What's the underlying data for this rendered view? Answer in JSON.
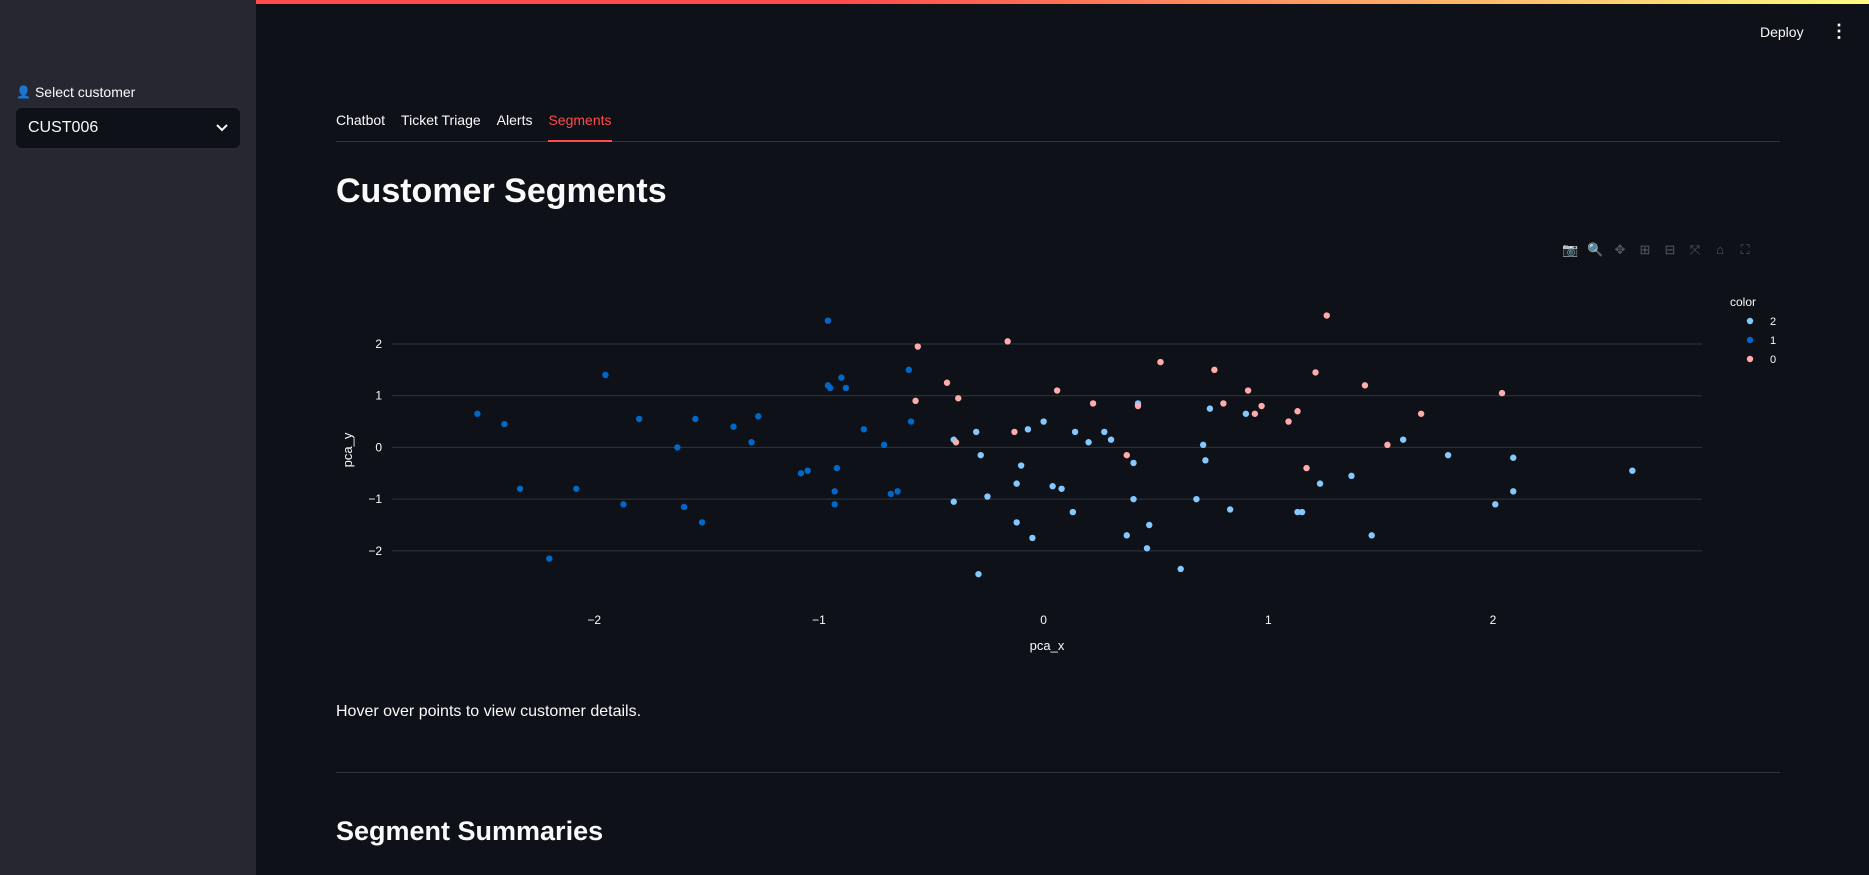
{
  "sidebar": {
    "select_label": "Select customer",
    "selected_customer": "CUST006"
  },
  "header": {
    "deploy_label": "Deploy",
    "menu_icon": "kebab-menu-icon"
  },
  "tabs": [
    {
      "label": "Chatbot",
      "active": false
    },
    {
      "label": "Ticket Triage",
      "active": false
    },
    {
      "label": "Alerts",
      "active": false
    },
    {
      "label": "Segments",
      "active": true
    }
  ],
  "page_title": "Customer Segments",
  "modebar_icons": [
    "camera-icon",
    "zoom-icon",
    "pan-icon",
    "zoom-in-icon",
    "zoom-out-icon",
    "autoscale-icon",
    "home-icon",
    "fullscreen-icon"
  ],
  "caption": "Hover over points to view customer details.",
  "section_title": "Segment Summaries",
  "colors": {
    "accent": "#ff4b4b",
    "bg": "#0e1117",
    "sidebar": "#262730",
    "c2": "#83c9ff",
    "c1": "#0068c9",
    "c0": "#ffabab"
  },
  "chart_data": {
    "type": "scatter",
    "xlabel": "pca_x",
    "ylabel": "pca_y",
    "xlim": [
      -2.9,
      2.93
    ],
    "ylim": [
      -2.95,
      2.85
    ],
    "xticks": [
      -2,
      -1,
      0,
      1,
      2
    ],
    "yticks": [
      -2,
      -1,
      0,
      1,
      2
    ],
    "legend_title": "color",
    "legend_position": "top-right",
    "series": [
      {
        "name": "2",
        "color": "#83c9ff",
        "points": [
          [
            -0.4,
            0.15
          ],
          [
            -0.3,
            0.3
          ],
          [
            -0.28,
            -0.15
          ],
          [
            -0.25,
            -0.95
          ],
          [
            -0.4,
            -1.05
          ],
          [
            -0.29,
            -2.45
          ],
          [
            -0.12,
            -0.7
          ],
          [
            -0.1,
            -0.35
          ],
          [
            -0.07,
            0.35
          ],
          [
            -0.12,
            -1.45
          ],
          [
            -0.05,
            -1.75
          ],
          [
            0.0,
            0.5
          ],
          [
            0.04,
            -0.75
          ],
          [
            0.08,
            -0.8
          ],
          [
            0.14,
            0.3
          ],
          [
            0.13,
            -1.25
          ],
          [
            0.2,
            0.1
          ],
          [
            0.27,
            0.3
          ],
          [
            0.3,
            0.15
          ],
          [
            0.4,
            -0.3
          ],
          [
            0.42,
            0.85
          ],
          [
            0.4,
            -1.0
          ],
          [
            0.37,
            -1.7
          ],
          [
            0.47,
            -1.5
          ],
          [
            0.46,
            -1.95
          ],
          [
            0.61,
            -2.35
          ],
          [
            0.68,
            -1.0
          ],
          [
            0.71,
            0.05
          ],
          [
            0.72,
            -0.25
          ],
          [
            0.74,
            0.75
          ],
          [
            0.83,
            -1.2
          ],
          [
            0.9,
            0.65
          ],
          [
            1.13,
            -1.25
          ],
          [
            1.15,
            -1.25
          ],
          [
            1.23,
            -0.7
          ],
          [
            1.37,
            -0.55
          ],
          [
            1.46,
            -1.7
          ],
          [
            1.6,
            0.15
          ],
          [
            1.8,
            -0.15
          ],
          [
            2.01,
            -1.1
          ],
          [
            2.09,
            -0.85
          ],
          [
            2.09,
            -0.2
          ],
          [
            2.62,
            -0.45
          ]
        ]
      },
      {
        "name": "1",
        "color": "#0068c9",
        "points": [
          [
            -2.52,
            0.65
          ],
          [
            -2.4,
            0.45
          ],
          [
            -2.33,
            -0.8
          ],
          [
            -2.2,
            -2.15
          ],
          [
            -2.08,
            -0.8
          ],
          [
            -1.95,
            1.4
          ],
          [
            -1.87,
            -1.1
          ],
          [
            -1.8,
            0.55
          ],
          [
            -1.63,
            0.0
          ],
          [
            -1.6,
            -1.15
          ],
          [
            -1.55,
            0.55
          ],
          [
            -1.52,
            -1.45
          ],
          [
            -1.38,
            0.4
          ],
          [
            -1.3,
            0.1
          ],
          [
            -1.27,
            0.6
          ],
          [
            -1.08,
            -0.5
          ],
          [
            -1.05,
            -0.45
          ],
          [
            -0.96,
            2.45
          ],
          [
            -0.96,
            1.2
          ],
          [
            -0.95,
            1.15
          ],
          [
            -0.92,
            -0.4
          ],
          [
            -0.93,
            -0.85
          ],
          [
            -0.93,
            -1.1
          ],
          [
            -0.9,
            1.35
          ],
          [
            -0.88,
            1.15
          ],
          [
            -0.8,
            0.35
          ],
          [
            -0.71,
            0.05
          ],
          [
            -0.68,
            -0.9
          ],
          [
            -0.65,
            -0.85
          ],
          [
            -0.6,
            1.5
          ],
          [
            -0.59,
            0.5
          ]
        ]
      },
      {
        "name": "0",
        "color": "#ffabab",
        "points": [
          [
            -0.56,
            1.95
          ],
          [
            -0.57,
            0.9
          ],
          [
            -0.43,
            1.25
          ],
          [
            -0.38,
            0.95
          ],
          [
            -0.39,
            0.1
          ],
          [
            -0.16,
            2.05
          ],
          [
            -0.13,
            0.3
          ],
          [
            0.06,
            1.1
          ],
          [
            0.22,
            0.85
          ],
          [
            0.37,
            -0.15
          ],
          [
            0.42,
            0.8
          ],
          [
            0.52,
            1.65
          ],
          [
            0.76,
            1.5
          ],
          [
            0.8,
            0.85
          ],
          [
            0.91,
            1.1
          ],
          [
            0.94,
            0.65
          ],
          [
            0.97,
            0.8
          ],
          [
            1.09,
            0.5
          ],
          [
            1.13,
            0.7
          ],
          [
            1.17,
            -0.4
          ],
          [
            1.21,
            1.45
          ],
          [
            1.26,
            2.55
          ],
          [
            1.43,
            1.2
          ],
          [
            1.53,
            0.05
          ],
          [
            1.68,
            0.65
          ],
          [
            2.04,
            1.05
          ]
        ]
      }
    ]
  }
}
